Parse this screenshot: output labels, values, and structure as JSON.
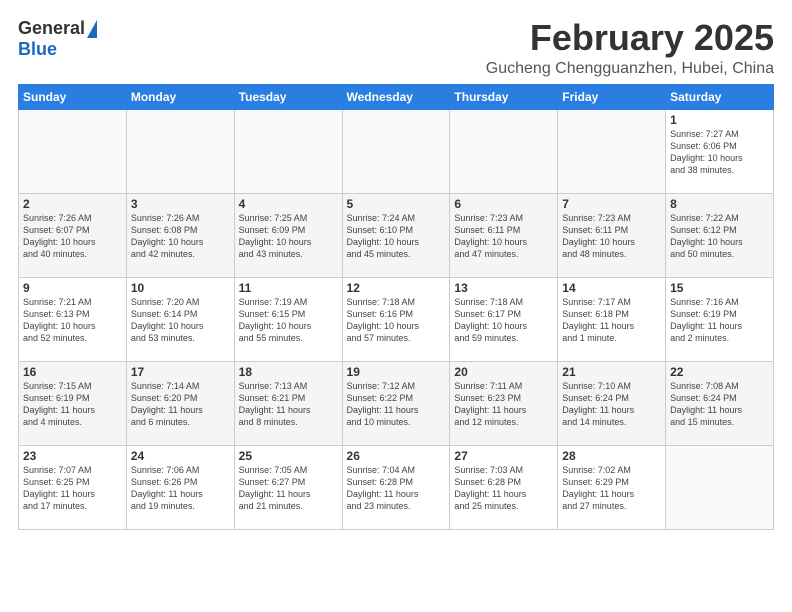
{
  "logo": {
    "general": "General",
    "blue": "Blue"
  },
  "title": {
    "month": "February 2025",
    "location": "Gucheng Chengguanzhen, Hubei, China"
  },
  "weekdays": [
    "Sunday",
    "Monday",
    "Tuesday",
    "Wednesday",
    "Thursday",
    "Friday",
    "Saturday"
  ],
  "weeks": [
    [
      {
        "day": "",
        "info": ""
      },
      {
        "day": "",
        "info": ""
      },
      {
        "day": "",
        "info": ""
      },
      {
        "day": "",
        "info": ""
      },
      {
        "day": "",
        "info": ""
      },
      {
        "day": "",
        "info": ""
      },
      {
        "day": "1",
        "info": "Sunrise: 7:27 AM\nSunset: 6:06 PM\nDaylight: 10 hours\nand 38 minutes."
      }
    ],
    [
      {
        "day": "2",
        "info": "Sunrise: 7:26 AM\nSunset: 6:07 PM\nDaylight: 10 hours\nand 40 minutes."
      },
      {
        "day": "3",
        "info": "Sunrise: 7:26 AM\nSunset: 6:08 PM\nDaylight: 10 hours\nand 42 minutes."
      },
      {
        "day": "4",
        "info": "Sunrise: 7:25 AM\nSunset: 6:09 PM\nDaylight: 10 hours\nand 43 minutes."
      },
      {
        "day": "5",
        "info": "Sunrise: 7:24 AM\nSunset: 6:10 PM\nDaylight: 10 hours\nand 45 minutes."
      },
      {
        "day": "6",
        "info": "Sunrise: 7:23 AM\nSunset: 6:11 PM\nDaylight: 10 hours\nand 47 minutes."
      },
      {
        "day": "7",
        "info": "Sunrise: 7:23 AM\nSunset: 6:11 PM\nDaylight: 10 hours\nand 48 minutes."
      },
      {
        "day": "8",
        "info": "Sunrise: 7:22 AM\nSunset: 6:12 PM\nDaylight: 10 hours\nand 50 minutes."
      }
    ],
    [
      {
        "day": "9",
        "info": "Sunrise: 7:21 AM\nSunset: 6:13 PM\nDaylight: 10 hours\nand 52 minutes."
      },
      {
        "day": "10",
        "info": "Sunrise: 7:20 AM\nSunset: 6:14 PM\nDaylight: 10 hours\nand 53 minutes."
      },
      {
        "day": "11",
        "info": "Sunrise: 7:19 AM\nSunset: 6:15 PM\nDaylight: 10 hours\nand 55 minutes."
      },
      {
        "day": "12",
        "info": "Sunrise: 7:18 AM\nSunset: 6:16 PM\nDaylight: 10 hours\nand 57 minutes."
      },
      {
        "day": "13",
        "info": "Sunrise: 7:18 AM\nSunset: 6:17 PM\nDaylight: 10 hours\nand 59 minutes."
      },
      {
        "day": "14",
        "info": "Sunrise: 7:17 AM\nSunset: 6:18 PM\nDaylight: 11 hours\nand 1 minute."
      },
      {
        "day": "15",
        "info": "Sunrise: 7:16 AM\nSunset: 6:19 PM\nDaylight: 11 hours\nand 2 minutes."
      }
    ],
    [
      {
        "day": "16",
        "info": "Sunrise: 7:15 AM\nSunset: 6:19 PM\nDaylight: 11 hours\nand 4 minutes."
      },
      {
        "day": "17",
        "info": "Sunrise: 7:14 AM\nSunset: 6:20 PM\nDaylight: 11 hours\nand 6 minutes."
      },
      {
        "day": "18",
        "info": "Sunrise: 7:13 AM\nSunset: 6:21 PM\nDaylight: 11 hours\nand 8 minutes."
      },
      {
        "day": "19",
        "info": "Sunrise: 7:12 AM\nSunset: 6:22 PM\nDaylight: 11 hours\nand 10 minutes."
      },
      {
        "day": "20",
        "info": "Sunrise: 7:11 AM\nSunset: 6:23 PM\nDaylight: 11 hours\nand 12 minutes."
      },
      {
        "day": "21",
        "info": "Sunrise: 7:10 AM\nSunset: 6:24 PM\nDaylight: 11 hours\nand 14 minutes."
      },
      {
        "day": "22",
        "info": "Sunrise: 7:08 AM\nSunset: 6:24 PM\nDaylight: 11 hours\nand 15 minutes."
      }
    ],
    [
      {
        "day": "23",
        "info": "Sunrise: 7:07 AM\nSunset: 6:25 PM\nDaylight: 11 hours\nand 17 minutes."
      },
      {
        "day": "24",
        "info": "Sunrise: 7:06 AM\nSunset: 6:26 PM\nDaylight: 11 hours\nand 19 minutes."
      },
      {
        "day": "25",
        "info": "Sunrise: 7:05 AM\nSunset: 6:27 PM\nDaylight: 11 hours\nand 21 minutes."
      },
      {
        "day": "26",
        "info": "Sunrise: 7:04 AM\nSunset: 6:28 PM\nDaylight: 11 hours\nand 23 minutes."
      },
      {
        "day": "27",
        "info": "Sunrise: 7:03 AM\nSunset: 6:28 PM\nDaylight: 11 hours\nand 25 minutes."
      },
      {
        "day": "28",
        "info": "Sunrise: 7:02 AM\nSunset: 6:29 PM\nDaylight: 11 hours\nand 27 minutes."
      },
      {
        "day": "",
        "info": ""
      }
    ]
  ]
}
